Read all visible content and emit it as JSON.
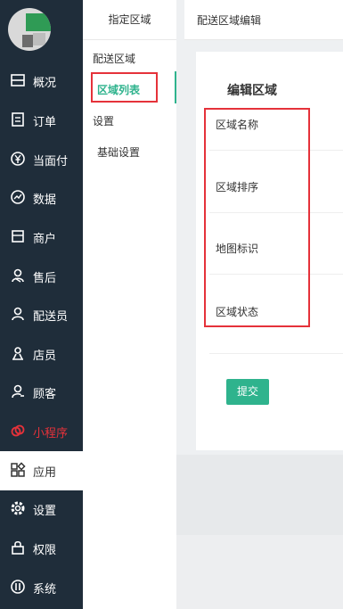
{
  "sidebar": {
    "items": [
      {
        "label": "概况",
        "icon": "overview-icon"
      },
      {
        "label": "订单",
        "icon": "order-icon"
      },
      {
        "label": "当面付",
        "icon": "yen-icon"
      },
      {
        "label": "数据",
        "icon": "chart-icon"
      },
      {
        "label": "商户",
        "icon": "shop-icon"
      },
      {
        "label": "售后",
        "icon": "after-sale-icon"
      },
      {
        "label": "配送员",
        "icon": "courier-icon"
      },
      {
        "label": "店员",
        "icon": "clerk-icon"
      },
      {
        "label": "顾客",
        "icon": "customer-icon"
      },
      {
        "label": "小程序",
        "icon": "mini-program-icon"
      },
      {
        "label": "应用",
        "icon": "apps-icon"
      },
      {
        "label": "设置",
        "icon": "gear-icon"
      },
      {
        "label": "权限",
        "icon": "lock-icon"
      },
      {
        "label": "系统",
        "icon": "system-icon"
      }
    ],
    "active_index": 10,
    "highlight_index": 9,
    "highlight_color": "#e5323a"
  },
  "subnav": {
    "title": "指定区域",
    "group_label": "配送区域",
    "current_item": "区域列表",
    "settings_group": "设置",
    "settings_item": "基础设置"
  },
  "main": {
    "header_title": "配送区域编辑",
    "panel_title": "编辑区域",
    "fields": [
      "区域名称",
      "区域排序",
      "地图标识",
      "区域状态"
    ],
    "submit_label": "提交"
  },
  "colors": {
    "sidebar_bg": "#1f2d3a",
    "accent": "#2fb38d",
    "annotation_red": "#e5323a"
  }
}
